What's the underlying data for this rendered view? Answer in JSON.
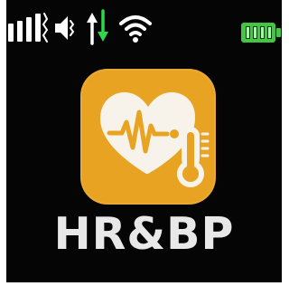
{
  "status_bar": {
    "icons": [
      "signal-strength-icon",
      "volume-icon",
      "mobile-data-icon",
      "wifi-icon",
      "battery-icon"
    ],
    "battery_level": 1.0
  },
  "colors": {
    "screen_background": "#050505",
    "app_icon_background": "#e8a323",
    "label_text": "#e8e8e8",
    "battery_fill": "#43c742",
    "data_up_arrow": "#ffffff",
    "data_down_arrow": "#2fd84a"
  },
  "app": {
    "label": "HR&BP",
    "icon": "heart-rate-thermometer-icon"
  }
}
